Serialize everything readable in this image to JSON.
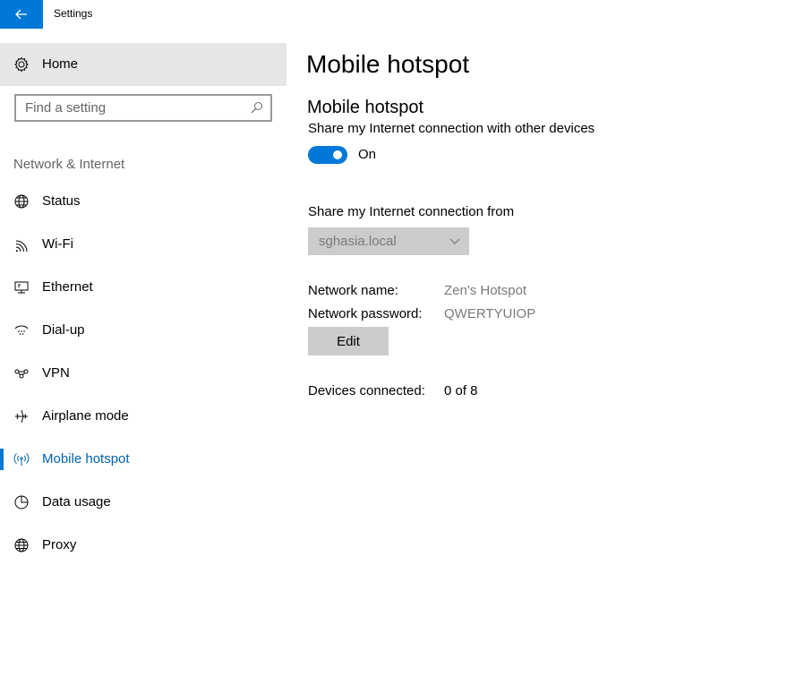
{
  "window": {
    "title": "Settings"
  },
  "sidebar": {
    "home_label": "Home",
    "search_placeholder": "Find a setting",
    "section_heading": "Network & Internet",
    "items": [
      {
        "label": "Status",
        "icon": "globe-status-icon"
      },
      {
        "label": "Wi-Fi",
        "icon": "wifi-icon"
      },
      {
        "label": "Ethernet",
        "icon": "ethernet-icon"
      },
      {
        "label": "Dial-up",
        "icon": "dial-up-icon"
      },
      {
        "label": "VPN",
        "icon": "vpn-icon"
      },
      {
        "label": "Airplane mode",
        "icon": "airplane-icon"
      },
      {
        "label": "Mobile hotspot",
        "icon": "hotspot-icon",
        "selected": true
      },
      {
        "label": "Data usage",
        "icon": "data-usage-icon"
      },
      {
        "label": "Proxy",
        "icon": "proxy-globe-icon"
      }
    ]
  },
  "main": {
    "page_title": "Mobile hotspot",
    "section_title": "Mobile hotspot",
    "share_description": "Share my Internet connection with other devices",
    "toggle_state": "On",
    "share_from_label": "Share my Internet connection from",
    "share_from_value": "sghasia.local",
    "network_name_label": "Network name:",
    "network_name_value": "Zen's Hotspot",
    "network_password_label": "Network password:",
    "network_password_value": "QWERTYUIOP",
    "edit_label": "Edit",
    "devices_connected_label": "Devices connected:",
    "devices_connected_value": "0 of 8"
  },
  "colors": {
    "accent": "#0078d7",
    "selected_text": "#0063b1",
    "home_bg": "#e6e6e6",
    "muted_text": "#7a7a7a"
  }
}
